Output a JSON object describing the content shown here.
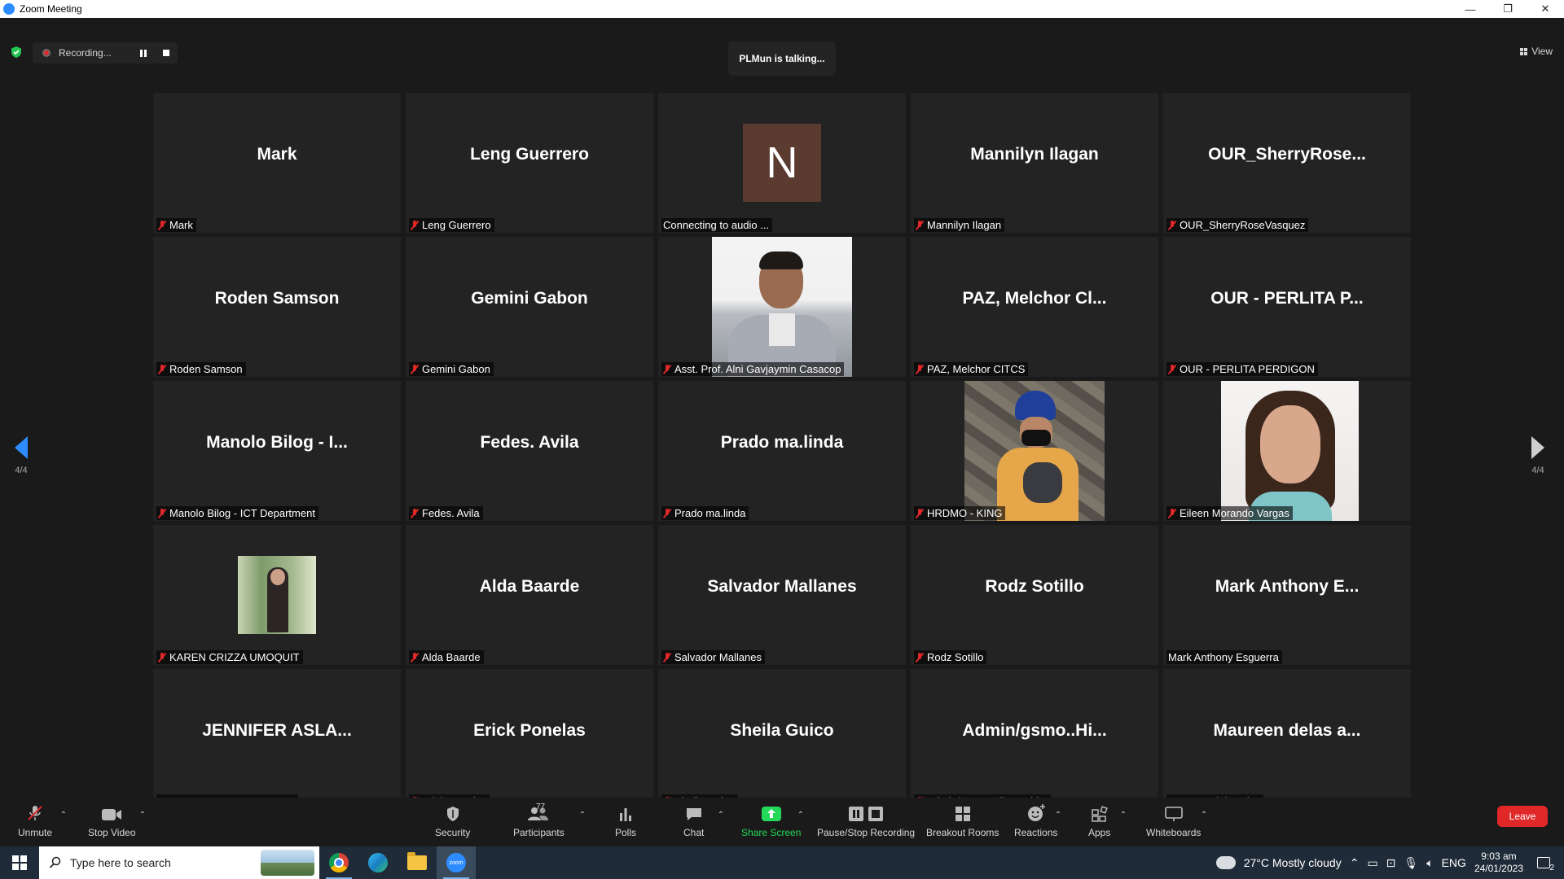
{
  "window": {
    "title": "Zoom Meeting",
    "minimize": "—",
    "restore": "❐",
    "close": "✕"
  },
  "recording": {
    "label": "Recording..."
  },
  "talking": "PLMun is talking...",
  "view_label": "View",
  "pager": {
    "left": "4/4",
    "right": "4/4"
  },
  "tiles": [
    {
      "big": "Mark",
      "label": "Mark",
      "muted": true
    },
    {
      "big": "Leng Guerrero",
      "label": "Leng Guerrero",
      "muted": true
    },
    {
      "big": "",
      "avatar_letter": "N",
      "label": "Connecting to audio ...",
      "muted": false
    },
    {
      "big": "Mannilyn Ilagan",
      "label": "Mannilyn Ilagan",
      "muted": true
    },
    {
      "big": "OUR_SherryRose...",
      "label": "OUR_SherryRoseVasquez",
      "muted": true
    },
    {
      "big": "Roden Samson",
      "label": "Roden Samson",
      "muted": true
    },
    {
      "big": "Gemini Gabon",
      "label": "Gemini Gabon",
      "muted": true
    },
    {
      "big": "",
      "photo": "suit",
      "label": "Asst. Prof. Alni Gavjaymin Casacop",
      "muted": true
    },
    {
      "big": "PAZ, Melchor Cl...",
      "label": "PAZ, Melchor CITCS",
      "muted": true
    },
    {
      "big": "OUR - PERLITA P...",
      "label": "OUR - PERLITA PERDIGON",
      "muted": true
    },
    {
      "big": "Manolo Bilog - I...",
      "label": "Manolo Bilog - ICT Department",
      "muted": true
    },
    {
      "big": "Fedes. Avila",
      "label": "Fedes. Avila",
      "muted": true
    },
    {
      "big": "Prado ma.linda",
      "label": "Prado ma.linda",
      "muted": true
    },
    {
      "big": "",
      "photo": "rock",
      "label": "HRDMO - KING",
      "muted": true
    },
    {
      "big": "",
      "photo": "woman",
      "label": "Eileen Morando Vargas",
      "muted": true
    },
    {
      "big": "",
      "photo": "small",
      "label": "KAREN CRIZZA UMOQUIT",
      "muted": true
    },
    {
      "big": "Alda Baarde",
      "label": "Alda Baarde",
      "muted": true
    },
    {
      "big": "Salvador Mallanes",
      "label": "Salvador Mallanes",
      "muted": true
    },
    {
      "big": "Rodz Sotillo",
      "label": "Rodz Sotillo",
      "muted": true
    },
    {
      "big": "Mark Anthony E...",
      "label": "Mark Anthony Esguerra",
      "muted": false
    },
    {
      "big": "JENNIFER  ASLA...",
      "label": "JENNIFER ASLAM- HRDMO",
      "muted": false
    },
    {
      "big": "Erick Ponelas",
      "label": "Erick Ponelas",
      "muted": true
    },
    {
      "big": "Sheila Guico",
      "label": "Sheila Guico",
      "muted": true
    },
    {
      "big": "Admin/gsmo..Hi...",
      "label": "Admin/gsmo..Hilapo abby",
      "muted": true
    },
    {
      "big": "Maureen delas a...",
      "label": "Maureen delas alas",
      "muted": false
    }
  ],
  "toolbar": {
    "unmute": "Unmute",
    "stop_video": "Stop Video",
    "security": "Security",
    "participants": "Participants",
    "participants_count": "77",
    "polls": "Polls",
    "chat": "Chat",
    "share_screen": "Share Screen",
    "pause_stop_recording": "Pause/Stop Recording",
    "breakout_rooms": "Breakout Rooms",
    "reactions": "Reactions",
    "apps": "Apps",
    "whiteboards": "Whiteboards",
    "leave": "Leave"
  },
  "taskbar": {
    "search_placeholder": "Type here to search",
    "weather": "27°C  Mostly cloudy",
    "language": "ENG",
    "time": "9:03 am",
    "date": "24/01/2023",
    "notifications": "2"
  },
  "colors": {
    "accent": "#2d8cff",
    "leave": "#e02828",
    "share": "#23d959",
    "muted": "#e02828"
  }
}
